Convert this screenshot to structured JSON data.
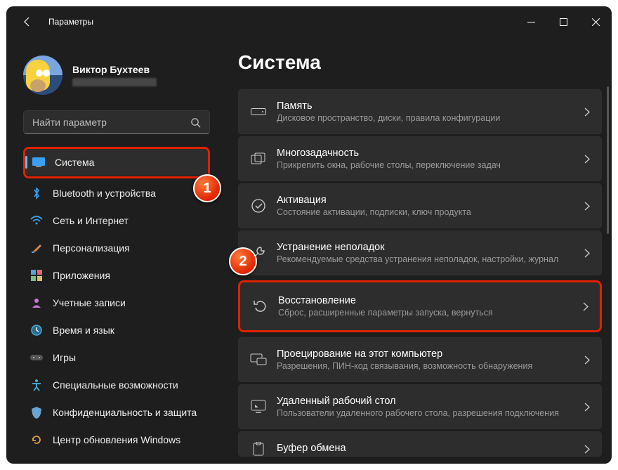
{
  "window": {
    "title": "Параметры"
  },
  "profile": {
    "name": "Виктор Бухтеев"
  },
  "search": {
    "placeholder": "Найти параметр"
  },
  "nav": {
    "system": "Система",
    "bluetooth": "Bluetooth и устройства",
    "network": "Сеть и Интернет",
    "personalization": "Персонализация",
    "apps": "Приложения",
    "accounts": "Учетные записи",
    "time": "Время и язык",
    "gaming": "Игры",
    "accessibility": "Специальные возможности",
    "privacy": "Конфиденциальность и защита",
    "update": "Центр обновления Windows"
  },
  "page": {
    "title": "Система"
  },
  "cards": {
    "storage": {
      "title": "Память",
      "sub": "Дисковое пространство, диски, правила конфигурации"
    },
    "multitask": {
      "title": "Многозадачность",
      "sub": "Прикрепить окна, рабочие столы, переключение задач"
    },
    "activation": {
      "title": "Активация",
      "sub": "Состояние активации, подписки, ключ продукта"
    },
    "troubleshoot": {
      "title": "Устранение неполадок",
      "sub": "Рекомендуемые средства устранения неполадок, настройки, журнал"
    },
    "recovery": {
      "title": "Восстановление",
      "sub": "Сброс, расширенные параметры запуска, вернуться"
    },
    "projecting": {
      "title": "Проецирование на этот компьютер",
      "sub": "Разрешения, ПИН-код связывания, возможность обнаружения"
    },
    "remote": {
      "title": "Удаленный рабочий стол",
      "sub": "Пользователи удаленного рабочего стола, разрешения подключения"
    },
    "clipboard": {
      "title": "Буфер обмена",
      "sub": ""
    }
  },
  "badges": {
    "one": "1",
    "two": "2"
  }
}
